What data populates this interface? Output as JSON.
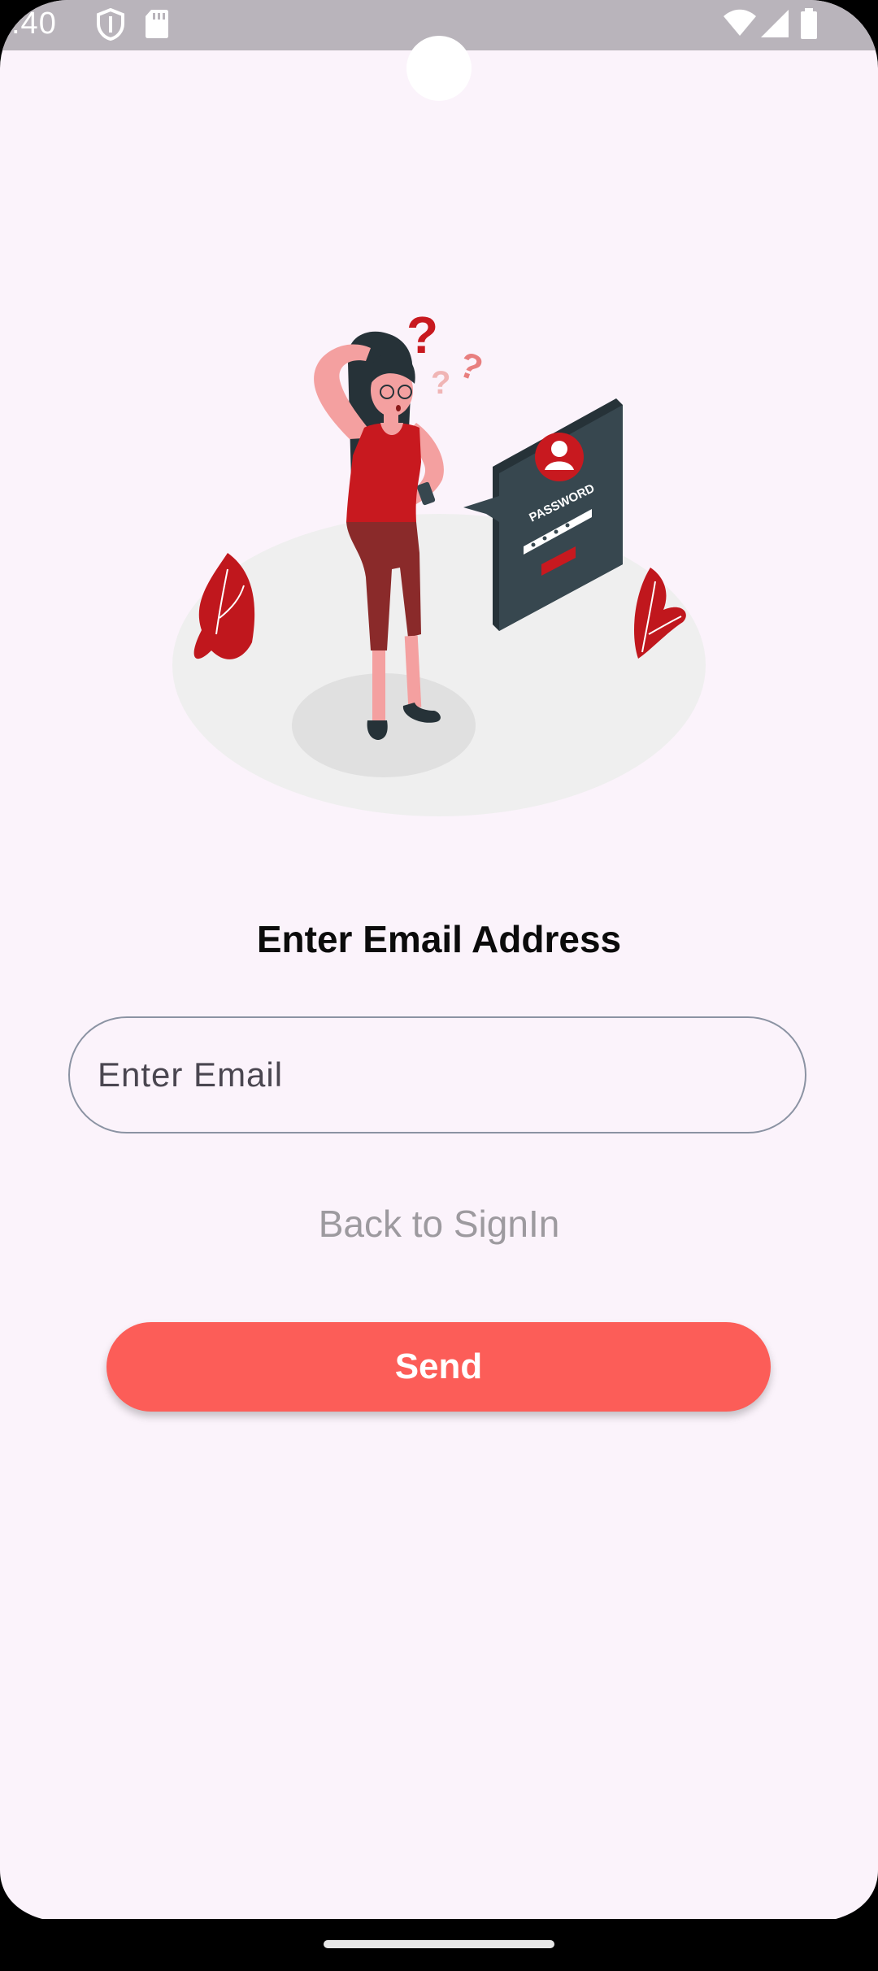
{
  "status_bar": {
    "time": ":40",
    "icons": [
      "shield-icon",
      "sd-card-icon",
      "wifi-icon",
      "signal-icon",
      "battery-icon"
    ]
  },
  "illustration": {
    "icon": "forgot-password-illustration",
    "card_text": "PASSWORD",
    "colors": {
      "accent": "#c8191f",
      "dark": "#37474f",
      "skin": "#f4a0a0",
      "ground": "#efefef"
    }
  },
  "form": {
    "title": "Enter Email Address",
    "email_placeholder": "Enter Email",
    "email_value": "",
    "back_link": "Back to SignIn",
    "send_label": "Send"
  },
  "colors": {
    "background": "#fbf3fb",
    "button": "#fc5d58",
    "link": "#9d9a9f",
    "field_border": "#8b93a3"
  }
}
